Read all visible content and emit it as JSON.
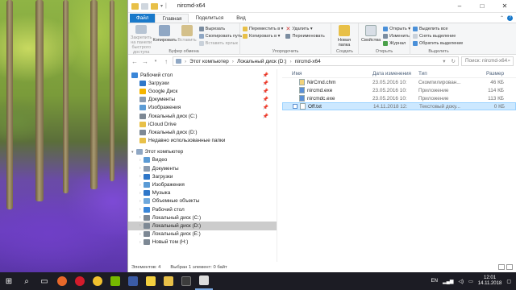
{
  "window": {
    "title": "nircmd-x64",
    "controls": {
      "minimize": "–",
      "maximize": "□",
      "close": "✕"
    }
  },
  "ribbon": {
    "tabs": [
      "Файл",
      "Главная",
      "Поделиться",
      "Вид"
    ],
    "groups": {
      "clipboard": {
        "label": "Буфер обмена",
        "pin": "Закрепить на панели быстрого доступа",
        "copy": "Копировать",
        "paste": "Вставить",
        "cut": "Вырезать",
        "copy_path": "Скопировать путь",
        "paste_shortcut": "Вставить ярлык"
      },
      "organize": {
        "label": "Упорядочить",
        "move_to": "Переместить в ▾",
        "copy_to": "Копировать в ▾",
        "delete": "Удалить ▾",
        "rename": "Переименовать"
      },
      "new": {
        "label": "Создать",
        "new_folder": "Новая папка"
      },
      "open": {
        "label": "Открыть",
        "properties": "Свойства",
        "open": "Открыть ▾",
        "edit": "Изменить",
        "history": "Журнал"
      },
      "select": {
        "label": "Выделить",
        "select_all": "Выделить все",
        "select_none": "Снять выделение",
        "invert": "Обратить выделение"
      }
    }
  },
  "address": {
    "crumbs": [
      "Этот компьютер",
      "Локальный диск (D:)",
      "nircmd-x64"
    ],
    "search_placeholder": "Поиск: nircmd-x64"
  },
  "nav": {
    "quick_access": [
      {
        "label": "Рабочий стол",
        "pinned": true,
        "color": "#3a86d8"
      },
      {
        "label": "Загрузки",
        "pinned": true,
        "color": "#2f77c9"
      },
      {
        "label": "Google Диск",
        "pinned": true,
        "color": "#f4b400"
      },
      {
        "label": "Документы",
        "pinned": true,
        "color": "#8a9bb0"
      },
      {
        "label": "Изображения",
        "pinned": true,
        "color": "#5b9bd5"
      },
      {
        "label": "Локальный диск (C:)",
        "pinned": true,
        "color": "#7d8894"
      },
      {
        "label": "iCloud Drive",
        "pinned": false,
        "color": "#e8c048"
      },
      {
        "label": "Локальный диск (D:)",
        "pinned": false,
        "color": "#7d8894"
      },
      {
        "label": "Недавно использованные папки",
        "pinned": false,
        "color": "#e8c048"
      }
    ],
    "this_pc_label": "Этот компьютер",
    "this_pc": [
      {
        "label": "Видео",
        "color": "#5b9bd5"
      },
      {
        "label": "Документы",
        "color": "#8a9bb0"
      },
      {
        "label": "Загрузки",
        "color": "#2f77c9"
      },
      {
        "label": "Изображения",
        "color": "#5b9bd5"
      },
      {
        "label": "Музыка",
        "color": "#2f77c9"
      },
      {
        "label": "Объемные объекты",
        "color": "#6fa8dc"
      },
      {
        "label": "Рабочий стол",
        "color": "#3a86d8"
      },
      {
        "label": "Локальный диск (C:)",
        "color": "#7d8894"
      },
      {
        "label": "Локальный диск (D:)",
        "color": "#7d8894"
      },
      {
        "label": "Локальный диск (E:)",
        "color": "#7d8894"
      },
      {
        "label": "Новый том (H:)",
        "color": "#7d8894"
      }
    ]
  },
  "files": {
    "headers": {
      "name": "Имя",
      "date": "Дата изменения",
      "type": "Тип",
      "size": "Размер"
    },
    "rows": [
      {
        "name": "NirCmd.chm",
        "date": "23.05.2016 10:",
        "type": "Скомпилирован...",
        "size": "46 КБ"
      },
      {
        "name": "nircmd.exe",
        "date": "23.05.2016 10:",
        "type": "Приложение",
        "size": "114 КБ"
      },
      {
        "name": "nircmdc.exe",
        "date": "23.05.2016 10:",
        "type": "Приложение",
        "size": "113 КБ"
      },
      {
        "name": "Off.txt",
        "date": "14.11.2018 12:",
        "type": "Текстовый доку...",
        "size": "0 КБ"
      }
    ]
  },
  "status": {
    "count": "Элементов: 4",
    "selected": "Выбран 1 элемент: 0 байт"
  },
  "taskbar": {
    "lang": "EN",
    "time": "12:01",
    "date": "14.11.2018"
  }
}
